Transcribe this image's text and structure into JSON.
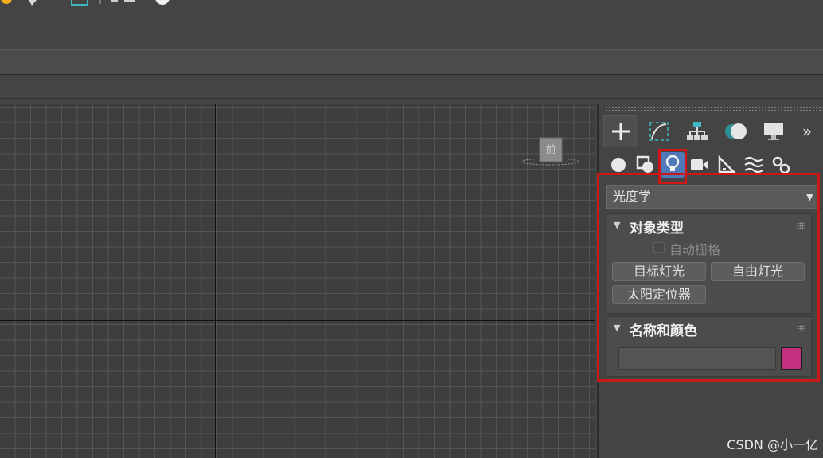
{
  "command_panel": {
    "tabs": [
      {
        "name": "create",
        "icon": "plus-icon"
      },
      {
        "name": "modify",
        "icon": "curve-icon"
      },
      {
        "name": "hierarchy",
        "icon": "hierarchy-icon"
      },
      {
        "name": "motion",
        "icon": "motion-icon"
      },
      {
        "name": "display",
        "icon": "display-icon"
      },
      {
        "name": "utilities",
        "label": "»"
      }
    ],
    "categories": [
      "geometry-icon",
      "shapes-icon",
      "lights-icon",
      "cameras-icon",
      "helpers-icon",
      "spacewarps-icon",
      "systems-icon"
    ],
    "dropdown": {
      "selected": "光度学"
    },
    "object_type": {
      "title": "对象类型",
      "autogrid_label": "自动栅格",
      "buttons": {
        "target": "目标灯光",
        "free": "自由灯光",
        "sun": "太阳定位器"
      }
    },
    "name_color": {
      "title": "名称和颜色",
      "name_value": "",
      "swatch_color": "#c2307e"
    }
  },
  "viewport": {
    "viewcube_label": "前"
  },
  "watermark": "CSDN @小一亿",
  "colors": {
    "highlight": "#c81818",
    "active_tab": "#4f79b8"
  }
}
